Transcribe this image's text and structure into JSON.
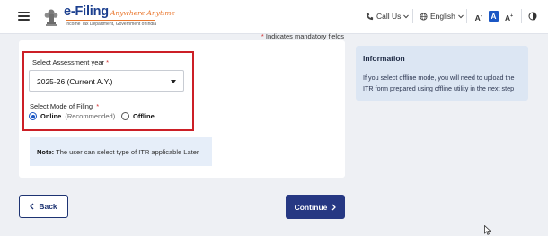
{
  "header": {
    "logo_main": "e-Filing",
    "logo_tagline": "Anywhere Anytime",
    "logo_sub": "Income Tax Department, Government of India",
    "call_us": "Call Us",
    "language": "English",
    "font_decrease": "A",
    "font_normal": "A",
    "font_increase": "A",
    "accent_color": "#1b57c4",
    "logo_color": "#1b3f8f",
    "tagline_color": "#e9752b"
  },
  "form": {
    "mandatory_note": "Indicates mandatory fields",
    "assessment_year_label": "Select Assessment year",
    "assessment_year_value": "2025-26  (Current A.Y.)",
    "mode_label": "Select Mode of Filing",
    "mode_options": [
      {
        "label": "Online",
        "hint": "(Recommended)",
        "selected": true
      },
      {
        "label": "Offline",
        "hint": "",
        "selected": false
      }
    ],
    "note_label": "Note:",
    "note_text": " The user can select type of ITR applicable Later",
    "highlight_color": "#cc1f26"
  },
  "info_panel": {
    "title": "Information",
    "body": "If you select offline mode, you will need to upload the ITR form prepared using offline utility in the next step"
  },
  "actions": {
    "back_label": "Back",
    "continue_label": "Continue",
    "primary_color": "#263883"
  },
  "icons": [
    "hamburger-icon",
    "emblem-icon",
    "phone-icon",
    "chevron-down-icon",
    "globe-icon",
    "contrast-icon",
    "chevron-left-icon",
    "chevron-right-icon",
    "mouse-pointer-icon"
  ]
}
